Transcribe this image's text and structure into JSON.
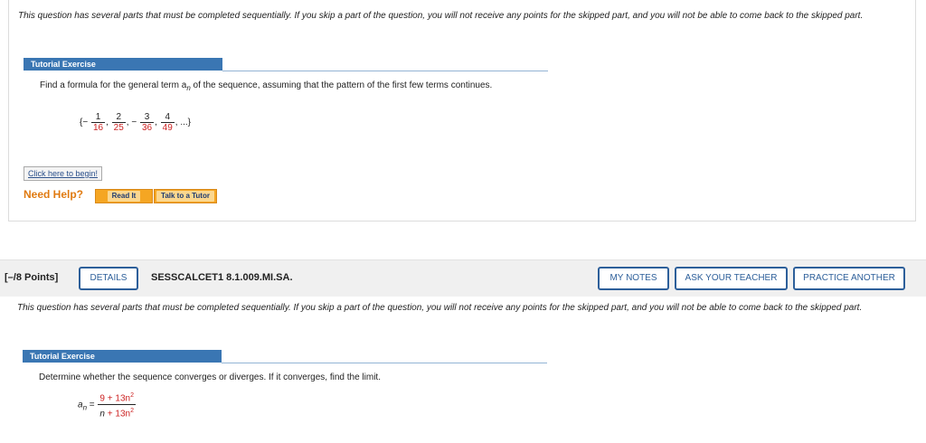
{
  "question1": {
    "intro": "This question has several parts that must be completed sequentially. If you skip a part of the question, you will not receive any points for the skipped part, and you will not be able to come back to the skipped part.",
    "tutorial_label": "Tutorial Exercise",
    "prompt": "Find a formula for the general term a",
    "prompt_sub": "n",
    "prompt_rest": " of the sequence, assuming that the pattern of the first few terms continues.",
    "sequence": {
      "open": "{−",
      "terms": [
        {
          "sign": "",
          "num": "1",
          "den": "16"
        },
        {
          "sign": "",
          "num": "2",
          "den": "25"
        },
        {
          "sign": "−",
          "num": "3",
          "den": "36"
        },
        {
          "sign": "",
          "num": "4",
          "den": "49"
        }
      ],
      "close": ", ...}"
    },
    "begin_label": "Click here to begin!",
    "need_help": "Need Help?",
    "read_it": "Read It",
    "talk_to_tutor": "Talk to a Tutor"
  },
  "question2": {
    "points": "[–/8 Points]",
    "details": "DETAILS",
    "id": "SESSCALCET1 8.1.009.MI.SA.",
    "my_notes": "MY NOTES",
    "ask_teacher": "ASK YOUR TEACHER",
    "practice_another": "PRACTICE ANOTHER",
    "intro": "This question has several parts that must be completed sequentially. If you skip a part of the question, you will not receive any points for the skipped part, and you will not be able to come back to the skipped part.",
    "tutorial_label": "Tutorial Exercise",
    "prompt": "Determine whether the sequence converges or diverges. If it converges, find the limit.",
    "formula": {
      "lhs": "a",
      "lhs_sub": "n",
      "eq": " = ",
      "num": "9 + 13n",
      "num_sup": "2",
      "den_n": "n",
      "den_rest": " + 13n",
      "den_sup": "2"
    }
  }
}
